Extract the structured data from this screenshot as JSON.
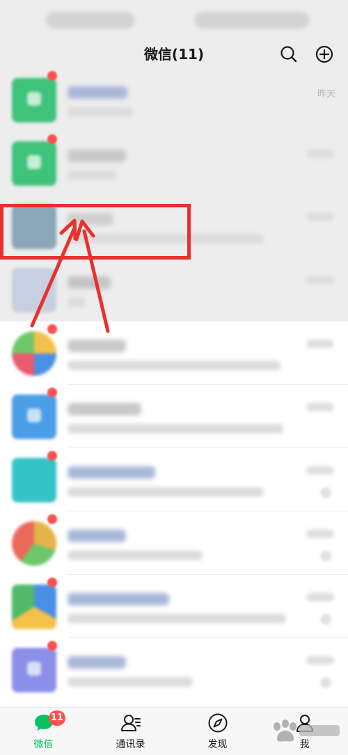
{
  "nav": {
    "title": "微信(11)",
    "icons": [
      "search-icon",
      "add-circle-icon"
    ]
  },
  "chat_list": {
    "first_time_label": "昨天",
    "avatar_colors": [
      "#3fc27a",
      "#3fc27a",
      "#8aa6b8",
      "#c7d0e0",
      "#6bb0e0",
      "#4a9ee6",
      "#35c3c8",
      "#e7b44a",
      "#52b96a",
      "#8b8fe8"
    ]
  },
  "tab_bar": {
    "badge": "11",
    "tabs": [
      {
        "label": "微信",
        "icon": "chat-bubble-icon",
        "active": true
      },
      {
        "label": "通讯录",
        "icon": "contacts-icon",
        "active": false
      },
      {
        "label": "发现",
        "icon": "compass-icon",
        "active": false
      },
      {
        "label": "我",
        "icon": "person-icon",
        "active": false
      }
    ],
    "accent_color": "#07c160"
  },
  "annotation": {
    "highlight_color": "#e8302e",
    "watermark_icon": "baidu-watermark-icon"
  }
}
